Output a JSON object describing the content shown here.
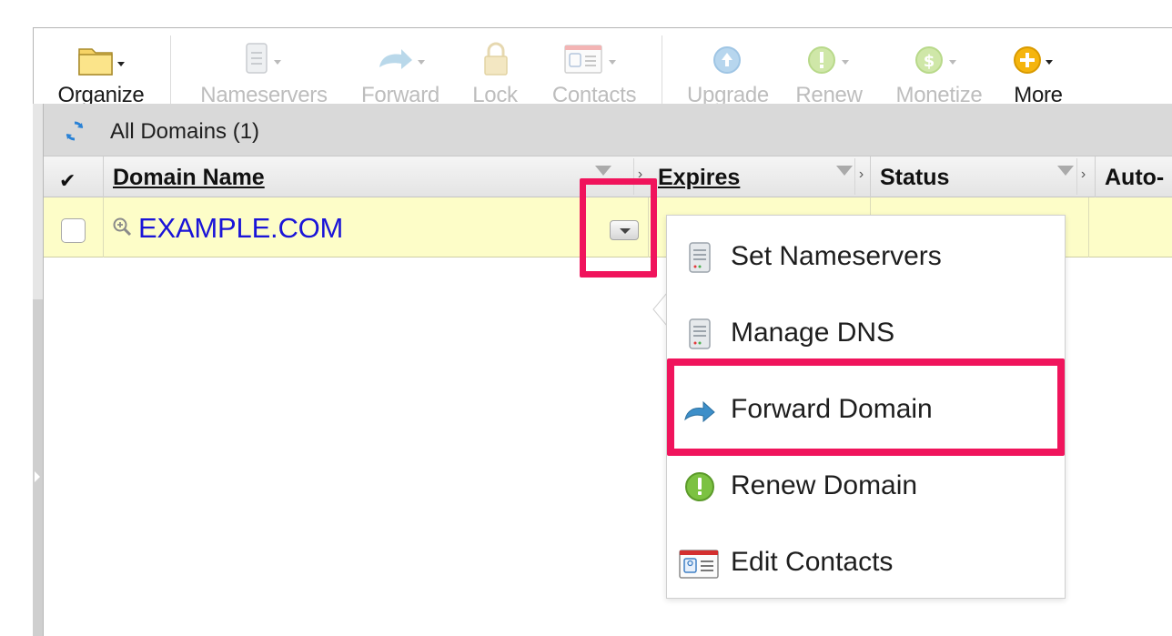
{
  "toolbar": {
    "organize": "Organize",
    "nameservers": "Nameservers",
    "forward": "Forward",
    "lock": "Lock",
    "contacts": "Contacts",
    "upgrade": "Upgrade",
    "renew": "Renew",
    "monetize": "Monetize",
    "more": "More"
  },
  "header": {
    "title": "All Domains (1)"
  },
  "columns": {
    "domain_name": "Domain Name",
    "expires": "Expires",
    "status": "Status",
    "auto": "Auto-"
  },
  "row": {
    "domain": "EXAMPLE.COM"
  },
  "menu": {
    "items": [
      {
        "label": "Set Nameservers",
        "icon": "server-icon"
      },
      {
        "label": "Manage DNS",
        "icon": "server-icon"
      },
      {
        "label": "Forward Domain",
        "icon": "forward-arrow-icon"
      },
      {
        "label": "Renew Domain",
        "icon": "renew-icon"
      },
      {
        "label": "Edit Contacts",
        "icon": "contact-card-icon"
      }
    ]
  },
  "colors": {
    "highlight": "#f0145c",
    "link": "#1a14d8",
    "row_bg": "#fdfdc8"
  }
}
